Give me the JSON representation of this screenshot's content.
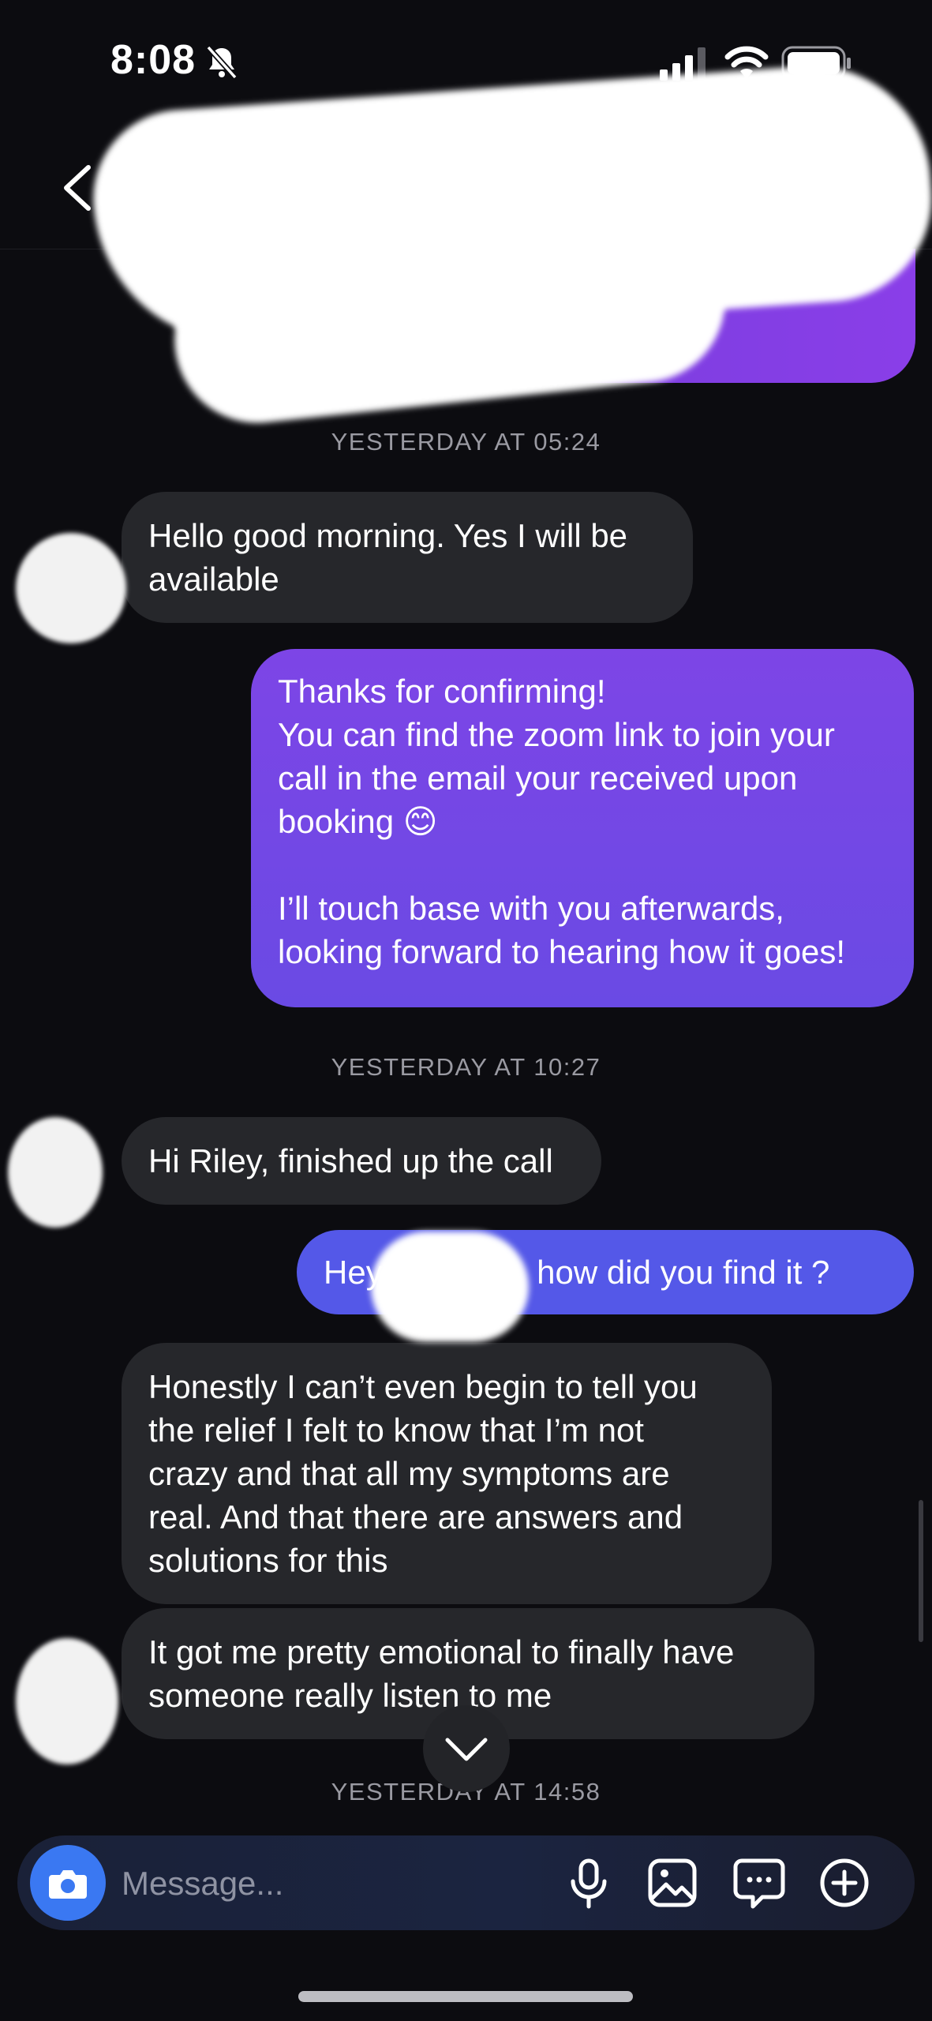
{
  "status_bar": {
    "time": "8:08",
    "icons": [
      "bell-slash-icon",
      "signal-icon",
      "wifi-icon",
      "battery-icon"
    ]
  },
  "header": {
    "back_icon": "chevron-left-icon",
    "tag_icon": "tag-icon"
  },
  "messages": [
    {
      "type": "timestamp",
      "text": "YESTERDAY AT 05:24"
    },
    {
      "type": "incoming",
      "text": "Hello good morning. Yes I will be\navailable"
    },
    {
      "type": "outgoing",
      "text": "Thanks for confirming!\nYou can find the zoom link to join your\ncall in the email your received upon\nbooking 😊\n\nI’ll touch base with you afterwards,\nlooking forward to hearing how it goes!"
    },
    {
      "type": "timestamp",
      "text": "YESTERDAY AT 10:27"
    },
    {
      "type": "incoming",
      "text": "Hi Riley, finished up the call"
    },
    {
      "type": "outgoing",
      "text": "Hey           😊  how did you find it ?"
    },
    {
      "type": "incoming",
      "text": "Honestly I can’t even begin to tell you\nthe relief I felt to know that I’m not\ncrazy and that all my symptoms are\nreal. And that there are answers and\nsolutions for this"
    },
    {
      "type": "incoming",
      "text": "It got me pretty emotional to finally have\nsomeone really listen to me"
    },
    {
      "type": "timestamp",
      "text": "YESTERDAY AT 14:58"
    }
  ],
  "composer": {
    "placeholder": "Message...",
    "icons": [
      "camera-icon",
      "microphone-icon",
      "image-icon",
      "sticker-chat-icon",
      "plus-circle-icon"
    ]
  },
  "colors": {
    "background": "#0c0c10",
    "incoming_bubble": "#26272b",
    "outgoing_gradient_top": "#7d45e6",
    "outgoing_gradient_bottom": "#6a4ae4",
    "outgoing_blue": "#5458e8",
    "accent_camera": "#3a78f2",
    "timestamp": "#9a9aa2"
  }
}
